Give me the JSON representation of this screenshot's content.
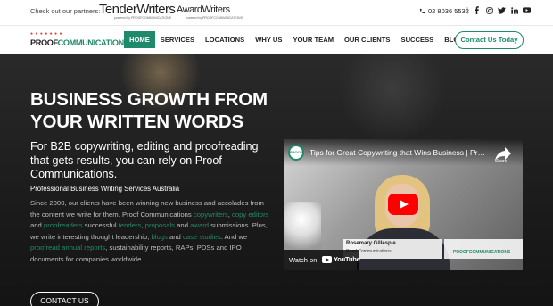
{
  "topbar": {
    "partners_label": "Check out our partners:",
    "partner_tender": "TenderWriters",
    "partner_tender_sub": "powered by PROOFCOMMUNICATIONS",
    "partner_award": "AwardWriters",
    "partner_award_sub": "powered by PROOFCOMMUNICATIONS",
    "phone": "02 8036 5532",
    "divider": "|",
    "social_icons": [
      "facebook-icon",
      "instagram-icon",
      "twitter-icon",
      "linkedin-icon",
      "youtube-icon"
    ]
  },
  "brand": {
    "dots": "● ● ● ● ● ● ●",
    "name_part1": "PROOF",
    "name_part2": "COMMUNICATIONS",
    "accent_color": "#1f8a6b"
  },
  "nav": {
    "items": [
      "HOME",
      "SERVICES",
      "LOCATIONS",
      "WHY US",
      "YOUR TEAM",
      "OUR CLIENTS",
      "SUCCESS",
      "BLOG"
    ],
    "active": "HOME",
    "cta": "Contact Us Today"
  },
  "hero": {
    "title": "BUSINESS GROWTH FROM YOUR WRITTEN WORDS",
    "lead": "For B2B copywriting, editing and proofreading that gets results, you can rely on Proof Communications.",
    "tagline": "Professional Business Writing Services Australia",
    "body": {
      "t1": "Since 2000, our clients have been winning new business and accolades from the content we write for them. Proof Communications ",
      "l1": "copywriters",
      "t2": ", ",
      "l2": "copy editors",
      "t3": " and ",
      "l3": "proofreaders",
      "t4": " successful ",
      "l4": "tenders",
      "t5": ", ",
      "l5": "proposals",
      "t6": " and ",
      "l6": "award",
      "t7": " submissions. Plus, we write interesting thought leadership, ",
      "l7": "blogs",
      "t8": " and ",
      "l8": "case studies",
      "t9": ". And we ",
      "l9": "proofread annual reports",
      "t10": ", sustainability reports, RAPs, PDSs and IPO documents for companies worldwide."
    },
    "cta": "CONTACT US"
  },
  "video": {
    "title": "Tips for Great Copywriting that Wins Business | Proo...",
    "channel_avatar": "PROOF",
    "share_label": "Share",
    "lower_name": "Rosemary Gillespie",
    "lower_role": "Proof Communications",
    "brand_tag": "PROOFCOMMUNICATIONS",
    "watch_on": "Watch on",
    "youtube": "YouTube"
  }
}
